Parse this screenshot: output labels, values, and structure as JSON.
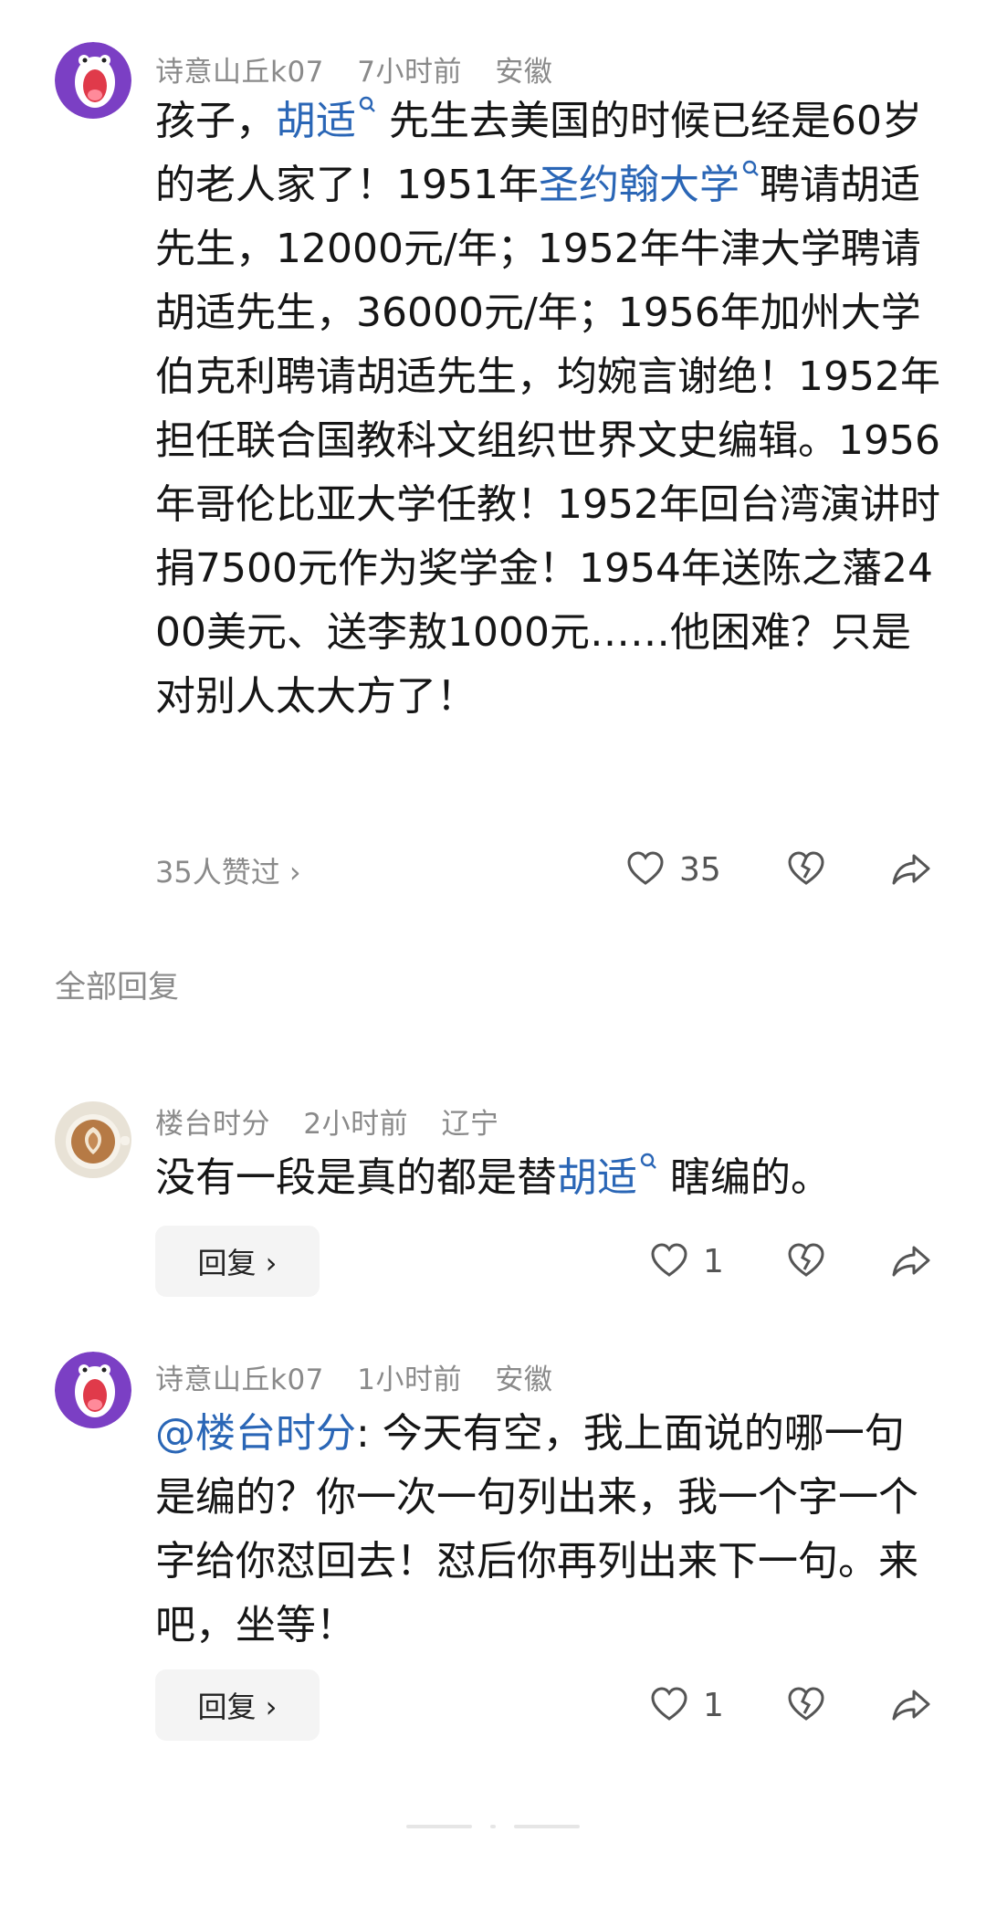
{
  "main_comment": {
    "username": "诗意山丘k07",
    "time": "7小时前",
    "location": "安徽",
    "text_parts": {
      "p1": "孩子，",
      "link1": "胡适",
      "p2": " 先生去美国的时候已经是60岁的老人家了！1951年",
      "link2": "圣约翰大学",
      "p3": "聘请胡适先生，12000元/年；1952年牛津大学聘请胡适先生，36000元/年；1956年加州大学伯克利聘请胡适先生，均婉言谢绝！1952年担任联合国教科文组织世界文史编辑。1956年哥伦比亚大学任教！1952年回台湾演讲时捐7500元作为奖学金！1954年送陈之藩2400美元、送李敖1000元……他困难？只是对别人太大方了！"
    },
    "likes_summary": "35人赞过 ›",
    "like_count": "35",
    "avatar_icon": "screaming-face-avatar"
  },
  "section_title": "全部回复",
  "replies": [
    {
      "username": "楼台时分",
      "time": "2小时前",
      "location": "辽宁",
      "text_parts": {
        "p1": "没有一段是真的都是替",
        "link1": "胡适",
        "p2": " 瞎编的。"
      },
      "reply_label": "回复 ›",
      "like_count": "1",
      "avatar_icon": "latte-art-avatar"
    },
    {
      "username": "诗意山丘k07",
      "time": "1小时前",
      "location": "安徽",
      "text_parts": {
        "mention": "@楼台时分",
        "p1": ": 今天有空，我上面说的哪一句是编的？你一次一句列出来，我一个字一个字给你怼回去！怼后你再列出来下一句。来吧，坐等！"
      },
      "reply_label": "回复 ›",
      "like_count": "1",
      "avatar_icon": "screaming-face-avatar"
    }
  ],
  "colors": {
    "link": "#2a66b6",
    "meta": "#8a8a8a",
    "avatar_purple": "#7b3fc4"
  }
}
